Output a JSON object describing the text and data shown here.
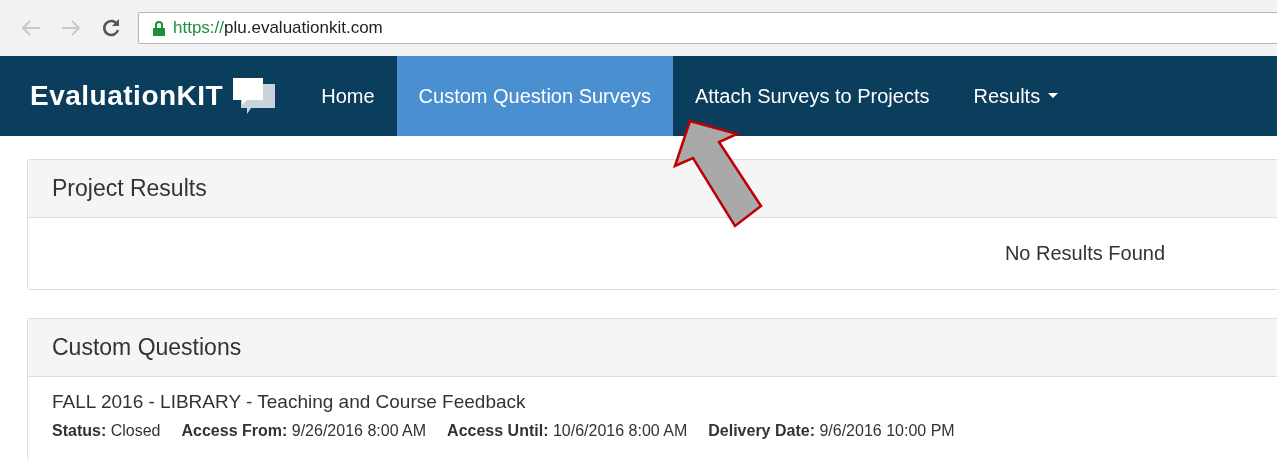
{
  "browser": {
    "url_scheme": "https://",
    "url_host": "plu.evaluationkit.com",
    "back_disabled": true,
    "forward_disabled": true,
    "secure": true
  },
  "nav": {
    "logo": "EvaluationKIT",
    "items": [
      {
        "label": "Home",
        "selected": false,
        "dropdown": false
      },
      {
        "label": "Custom Question Surveys",
        "selected": true,
        "dropdown": false
      },
      {
        "label": "Attach Surveys to Projects",
        "selected": false,
        "dropdown": false
      },
      {
        "label": "Results",
        "selected": false,
        "dropdown": true
      }
    ]
  },
  "project_results": {
    "title": "Project Results",
    "empty_message": "No Results Found"
  },
  "custom_questions": {
    "title": "Custom Questions",
    "items": [
      {
        "title": "FALL 2016 - LIBRARY - Teaching and Course Feedback",
        "meta": [
          "**Status:** Closed",
          "**Access From:** 9/26/2016 8:00 AM",
          "**Access Until:** 10/6/2016 8:00 AM",
          "**Delivery Date:** 9/6/2016 10:00 PM"
        ]
      }
    ]
  },
  "annotation": {
    "kind": "arrow"
  }
}
